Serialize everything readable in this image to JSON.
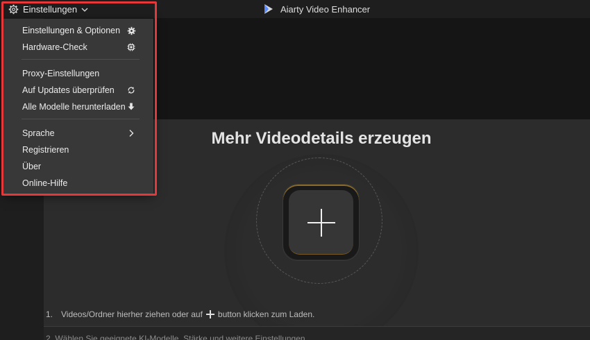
{
  "titlebar": {
    "app_title": "Aiarty Video Enhancer",
    "settings_label": "Einstellungen"
  },
  "menu": {
    "items": [
      {
        "label": "Einstellungen & Optionen",
        "icon": "gear-icon"
      },
      {
        "label": "Hardware-Check",
        "icon": "chip-icon"
      },
      {
        "label": "Proxy-Einstellungen",
        "icon": ""
      },
      {
        "label": "Auf Updates überprüfen",
        "icon": "refresh-icon"
      },
      {
        "label": "Alle Modelle herunterladen",
        "icon": "download-icon"
      },
      {
        "label": "Sprache",
        "icon": "chevron-right-icon"
      },
      {
        "label": "Registrieren",
        "icon": ""
      },
      {
        "label": "Über",
        "icon": ""
      },
      {
        "label": "Online-Hilfe",
        "icon": ""
      }
    ]
  },
  "main": {
    "title": "Mehr Videodetails erzeugen",
    "step1_num": "1.",
    "step1_prefix": "Videos/Ordner hierher ziehen oder auf",
    "step1_suffix": "button klicken zum Laden.",
    "step2_text": "2.    Wählen Sie geeignete KI-Modelle, Stärke und weitere Einstellungen"
  },
  "colors": {
    "highlight": "#e5383b",
    "accent_rim": "#8a6a2a",
    "panel": "#2c2c2c",
    "menu_bg": "#383838"
  }
}
